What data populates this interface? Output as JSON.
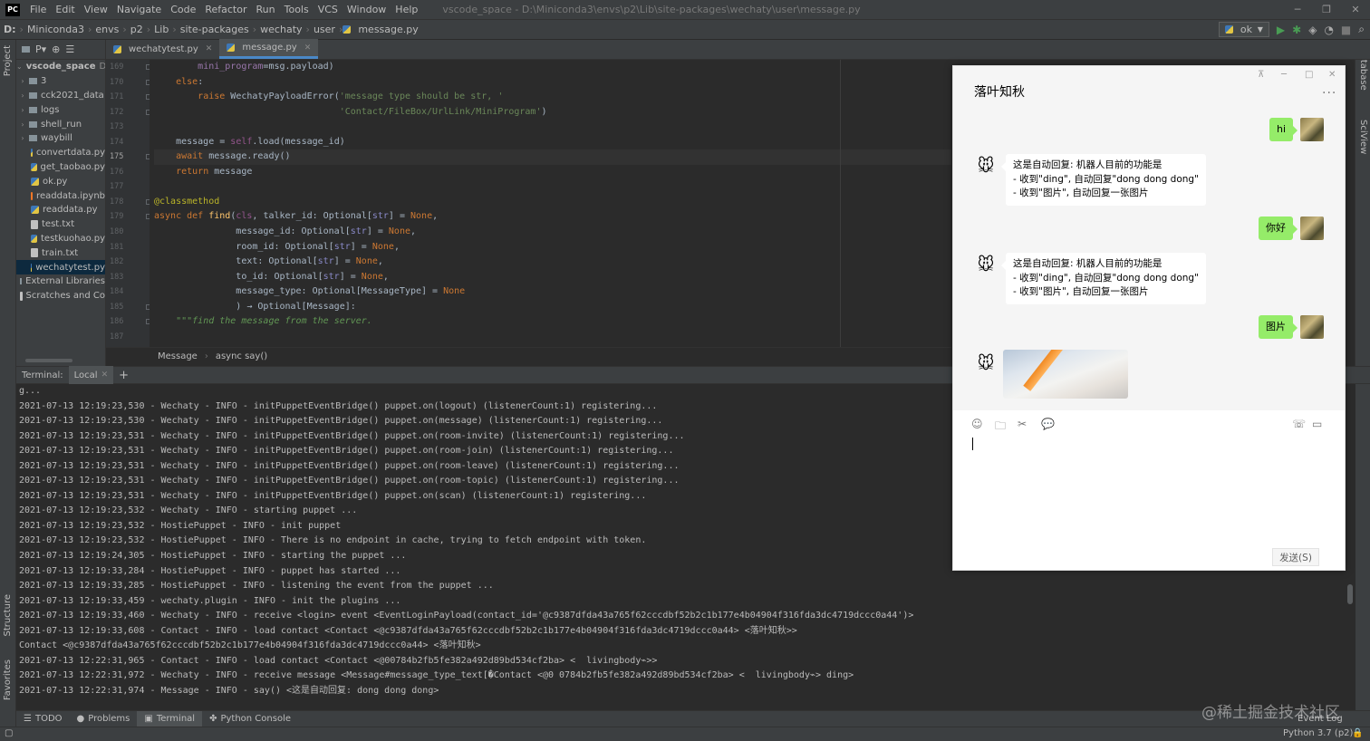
{
  "menu": {
    "logo": "PC",
    "items": [
      "File",
      "Edit",
      "View",
      "Navigate",
      "Code",
      "Refactor",
      "Run",
      "Tools",
      "VCS",
      "Window",
      "Help"
    ],
    "window_title": "vscode_space - D:\\Miniconda3\\envs\\p2\\Lib\\site-packages\\wechaty\\user\\message.py"
  },
  "nav": {
    "crumbs": [
      "D:",
      "Miniconda3",
      "envs",
      "p2",
      "Lib",
      "site-packages",
      "wechaty",
      "user",
      "message.py"
    ],
    "run_config": "ok"
  },
  "project": {
    "header": "P▾",
    "rows": [
      {
        "label": "vscode_space",
        "suffix": "D:",
        "type": "root",
        "indent": 0
      },
      {
        "label": "3",
        "type": "folder",
        "indent": 1
      },
      {
        "label": "cck2021_data",
        "type": "folder",
        "indent": 1
      },
      {
        "label": "logs",
        "type": "folder",
        "indent": 1
      },
      {
        "label": "shell_run",
        "type": "folder",
        "indent": 1
      },
      {
        "label": "waybill",
        "type": "folder",
        "indent": 1
      },
      {
        "label": "convertdata.py",
        "type": "py",
        "indent": 2
      },
      {
        "label": "get_taobao.py",
        "type": "py",
        "indent": 2
      },
      {
        "label": "ok.py",
        "type": "py",
        "indent": 2
      },
      {
        "label": "readdata.ipynb",
        "type": "ipynb",
        "indent": 2
      },
      {
        "label": "readdata.py",
        "type": "py",
        "indent": 2
      },
      {
        "label": "test.txt",
        "type": "txt",
        "indent": 2
      },
      {
        "label": "testkuohao.py",
        "type": "py",
        "indent": 2
      },
      {
        "label": "train.txt",
        "type": "txt",
        "indent": 2
      },
      {
        "label": "wechatytest.py",
        "type": "py",
        "indent": 2,
        "selected": true
      },
      {
        "label": "External Libraries",
        "type": "lib",
        "indent": 0
      },
      {
        "label": "Scratches and Co",
        "type": "scratch",
        "indent": 0
      }
    ]
  },
  "tabs": [
    {
      "label": "wechatytest.py",
      "active": false
    },
    {
      "label": "message.py",
      "active": true
    }
  ],
  "editor": {
    "line_numbers": [
      "169",
      "170",
      "171",
      "172",
      "173",
      "174",
      "175",
      "176",
      "177",
      "178",
      "179",
      "180",
      "181",
      "182",
      "183",
      "184",
      "185",
      "186",
      "187"
    ],
    "current_line": "175",
    "breadcrumb": [
      "Message",
      "async say()"
    ]
  },
  "terminal": {
    "label": "Terminal:",
    "tab": "Local",
    "lines": [
      "g...",
      "2021-07-13 12:19:23,530 - Wechaty - INFO - initPuppetEventBridge() puppet.on(logout) (listenerCount:1) registering...",
      "2021-07-13 12:19:23,530 - Wechaty - INFO - initPuppetEventBridge() puppet.on(message) (listenerCount:1) registering...",
      "2021-07-13 12:19:23,531 - Wechaty - INFO - initPuppetEventBridge() puppet.on(room-invite) (listenerCount:1) registering...",
      "2021-07-13 12:19:23,531 - Wechaty - INFO - initPuppetEventBridge() puppet.on(room-join) (listenerCount:1) registering...",
      "2021-07-13 12:19:23,531 - Wechaty - INFO - initPuppetEventBridge() puppet.on(room-leave) (listenerCount:1) registering...",
      "2021-07-13 12:19:23,531 - Wechaty - INFO - initPuppetEventBridge() puppet.on(room-topic) (listenerCount:1) registering...",
      "2021-07-13 12:19:23,531 - Wechaty - INFO - initPuppetEventBridge() puppet.on(scan) (listenerCount:1) registering...",
      "2021-07-13 12:19:23,532 - Wechaty - INFO - starting puppet ...",
      "2021-07-13 12:19:23,532 - HostiePuppet - INFO - init puppet",
      "2021-07-13 12:19:23,532 - HostiePuppet - INFO - There is no endpoint in cache, trying to fetch endpoint with token.",
      "2021-07-13 12:19:24,305 - HostiePuppet - INFO - starting the puppet ...",
      "2021-07-13 12:19:33,284 - HostiePuppet - INFO - puppet has started ...",
      "2021-07-13 12:19:33,285 - HostiePuppet - INFO - listening the event from the puppet ...",
      "2021-07-13 12:19:33,459 - wechaty.plugin - INFO - init the plugins ...",
      "2021-07-13 12:19:33,460 - Wechaty - INFO - receive <login> event <EventLoginPayload(contact_id='@c9387dfda43a765f62cccdbf52b2c1b177e4b04904f316fda3dc4719dccc0a44')>",
      "2021-07-13 12:19:33,608 - Contact - INFO - load contact <Contact <@c9387dfda43a765f62cccdbf52b2c1b177e4b04904f316fda3dc4719dccc0a44> <落叶知秋>>",
      "Contact <@c9387dfda43a765f62cccdbf52b2c1b177e4b04904f316fda3dc4719dccc0a44> <落叶知秋>",
      "2021-07-13 12:22:31,965 - Contact - INFO - load contact <Contact <@00784b2fb5fe382a492d89bd534cf2ba> <  livingbody⌁>>",
      "2021-07-13 12:22:31,972 - Wechaty - INFO - receive message <Message#message_type_text[�Contact <@0 0784b2fb5fe382a492d89bd534cf2ba> <  livingbody⌁> ding>",
      "2021-07-13 12:22:31,974 - Message - INFO - say() <这是自动回复: dong dong dong>"
    ]
  },
  "toolwindows": [
    "TODO",
    "Problems",
    "Terminal",
    "Python Console"
  ],
  "status": {
    "interpreter": "Python 3.7 (p2)",
    "event_log": "Event Log"
  },
  "side_labels": {
    "left_top": "Project",
    "left_mid": "Structure",
    "left_bottom": "Favorites",
    "right_top": "Database",
    "right_mid": "SciView"
  },
  "watermark": "@稀土掘金技术社区",
  "wechat": {
    "title": "落叶知秋",
    "more": "···",
    "messages": [
      {
        "from": "me",
        "text": "hi"
      },
      {
        "from": "bot",
        "text": "这是自动回复: 机器人目前的功能是\n- 收到\"ding\", 自动回复\"dong dong dong\"\n- 收到\"图片\", 自动回复一张图片"
      },
      {
        "from": "me",
        "text": "你好"
      },
      {
        "from": "bot",
        "text": "这是自动回复: 机器人目前的功能是\n- 收到\"ding\", 自动回复\"dong dong dong\"\n- 收到\"图片\", 自动回复一张图片"
      },
      {
        "from": "me",
        "text": "图片"
      },
      {
        "from": "bot",
        "type": "image"
      }
    ],
    "send_label": "发送(S)",
    "bot_avatar_glyph": "🐭"
  }
}
